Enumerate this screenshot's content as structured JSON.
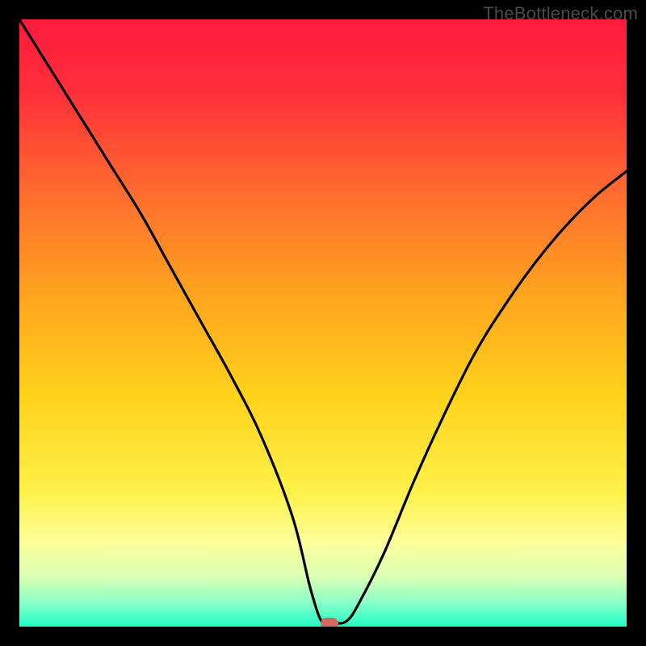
{
  "watermark": "TheBottleneck.com",
  "marker_color": "#cf6a63",
  "chart_data": {
    "type": "line",
    "title": "",
    "xlabel": "",
    "ylabel": "",
    "xlim": [
      0,
      100
    ],
    "ylim": [
      0,
      100
    ],
    "grid": false,
    "legend": false,
    "background_gradient": {
      "stops": [
        {
          "pos": 0.0,
          "color": "#ff1a3c"
        },
        {
          "pos": 0.12,
          "color": "#ff2f3a"
        },
        {
          "pos": 0.28,
          "color": "#ff6a2f"
        },
        {
          "pos": 0.45,
          "color": "#ffa31f"
        },
        {
          "pos": 0.62,
          "color": "#ffd21a"
        },
        {
          "pos": 0.78,
          "color": "#fff14a"
        },
        {
          "pos": 0.86,
          "color": "#fdff9a"
        },
        {
          "pos": 0.92,
          "color": "#d8ffb5"
        },
        {
          "pos": 0.96,
          "color": "#8affc8"
        },
        {
          "pos": 1.0,
          "color": "#1fffc4"
        }
      ]
    },
    "series": [
      {
        "name": "bottleneck-curve",
        "color": "#000000",
        "x": [
          0,
          5,
          10,
          15,
          20,
          25,
          30,
          35,
          40,
          45,
          48,
          50,
          52,
          54,
          56,
          60,
          65,
          70,
          75,
          80,
          85,
          90,
          95,
          100
        ],
        "y": [
          100,
          92,
          84,
          76,
          68,
          59,
          50,
          41,
          31,
          18,
          6,
          0.5,
          0.5,
          1,
          4,
          12,
          24,
          35,
          45,
          53,
          60,
          66,
          71,
          75
        ]
      }
    ],
    "marker": {
      "x": 51,
      "y": 0.5
    }
  }
}
